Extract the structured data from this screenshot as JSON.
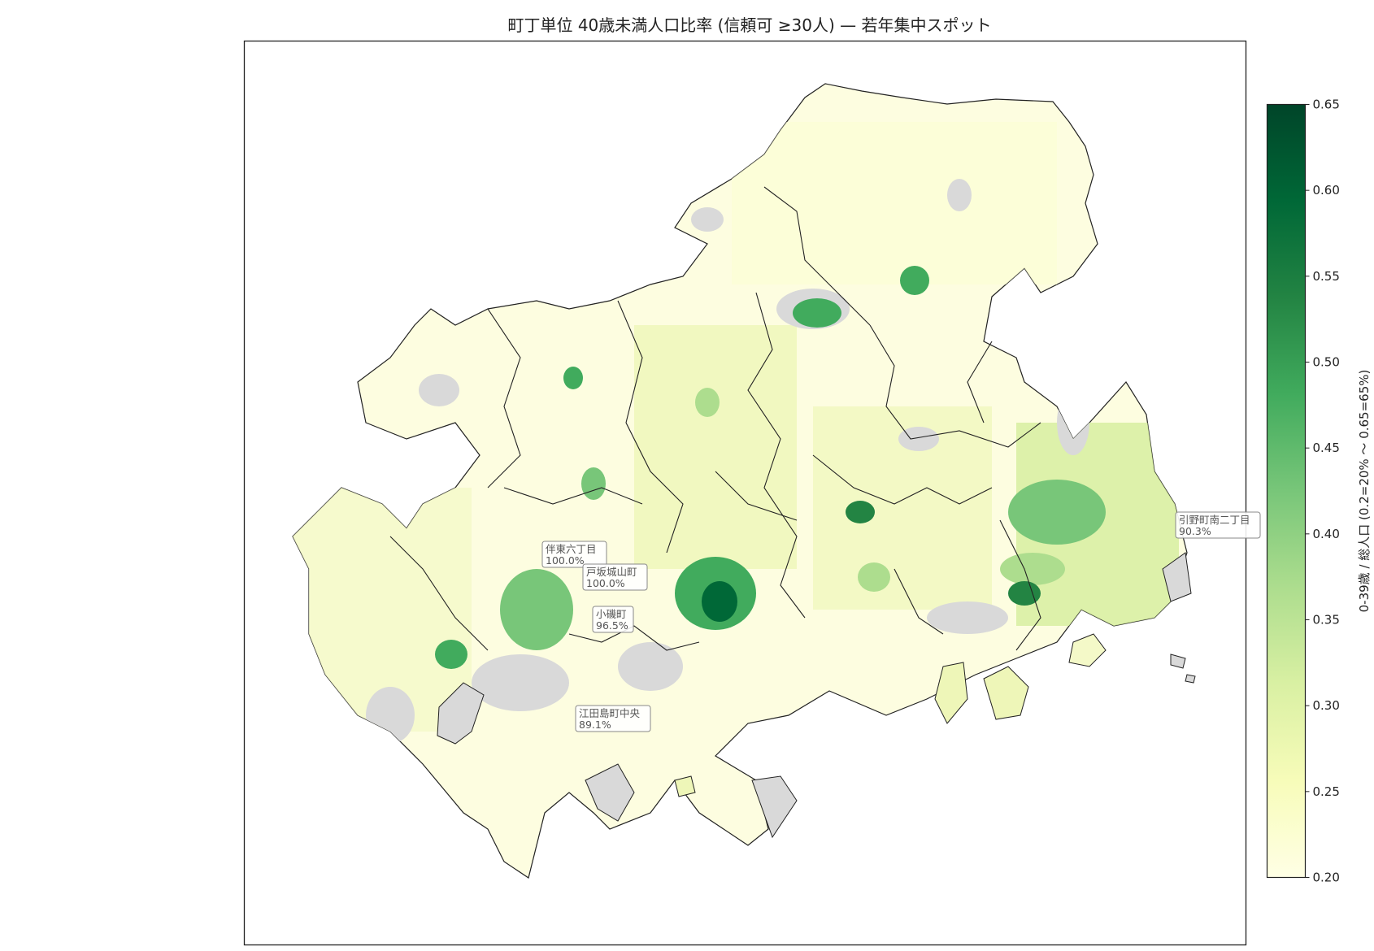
{
  "title": "町丁単位 40歳未満人口比率 (信頼可 ≥30人) — 若年集中スポット",
  "colorbar": {
    "label": "0-39歳 / 総人口 (0.2=20% ～ 0.65=65%)",
    "min": 0.2,
    "max": 0.65,
    "ticks": [
      "0.20",
      "0.25",
      "0.30",
      "0.35",
      "0.40",
      "0.45",
      "0.50",
      "0.55",
      "0.60",
      "0.65"
    ],
    "colormap": "YlGn",
    "stops": [
      "#ffffe5",
      "#f7fcb9",
      "#d9f0a3",
      "#addd8e",
      "#78c679",
      "#41ab5d",
      "#238443",
      "#006837",
      "#004529"
    ]
  },
  "colors": {
    "no_data": "#d9d9d9",
    "boundary": "#222222",
    "frame": "#222222"
  },
  "annotations": [
    {
      "name": "伴東六丁目",
      "value": "100.0%"
    },
    {
      "name": "戸坂城山町",
      "value": "100.0%"
    },
    {
      "name": "小磯町",
      "value": "96.5%"
    },
    {
      "name": "江田島町中央",
      "value": "89.1%"
    },
    {
      "name": "引野町南二丁目",
      "value": "90.3%"
    }
  ]
}
